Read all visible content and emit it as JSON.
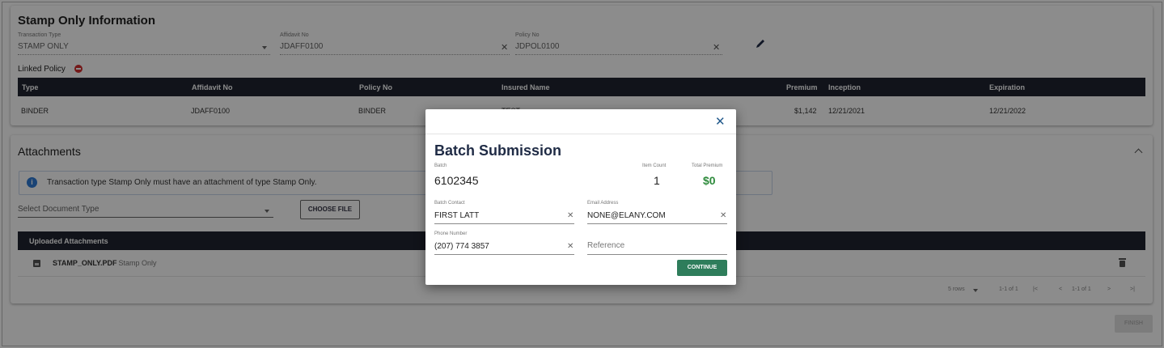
{
  "stamp": {
    "title": "Stamp Only Information",
    "transaction_type_label": "Transaction Type",
    "transaction_type_value": "STAMP ONLY",
    "affidavit_label": "Affidavit No",
    "affidavit_value": "JDAFF0100",
    "policy_label": "Policy No",
    "policy_value": "JDPOL0100",
    "linked_policy_label": "Linked Policy",
    "table": {
      "headers": [
        "Type",
        "Affidavit No",
        "Policy No",
        "Insured Name",
        "Premium",
        "Inception",
        "Expiration"
      ],
      "row": {
        "type": "BINDER",
        "affidavit": "JDAFF0100",
        "policy": "BINDER",
        "insured": "TEST",
        "premium": "$1,142",
        "inception": "12/21/2021",
        "expiration": "12/21/2022"
      }
    }
  },
  "attachments": {
    "title": "Attachments",
    "info_text": "Transaction type Stamp Only must have an attachment of type Stamp Only.",
    "doc_type_placeholder": "Select Document Type",
    "choose_file_label": "CHOOSE FILE",
    "uploaded_header": "Uploaded Attachments",
    "file_name": "STAMP_ONLY.PDF",
    "file_type": " - Stamp Only",
    "pager": {
      "rows_label": "5 rows",
      "range": "1-1 of 1",
      "range2": "1-1 of 1",
      "first": "|<",
      "prev": "<",
      "next": ">",
      "last": ">|"
    }
  },
  "finish_label": "FINISH",
  "modal": {
    "title": "Batch Submission",
    "batch_label": "Batch",
    "batch_value": "6102345",
    "item_count_label": "Item Count",
    "item_count_value": "1",
    "total_premium_label": "Total Premium",
    "total_premium_value": "$0",
    "contact_label": "Batch Contact",
    "contact_value": "FIRST LATT",
    "email_label": "Email Address",
    "email_value": "NONE@ELANY.COM",
    "phone_label": "Phone Number",
    "phone_value": "(207) 774 3857",
    "reference_placeholder": "Reference",
    "continue_label": "CONTINUE",
    "close_symbol": "✕"
  },
  "colors": {
    "header_dark": "#1f2431",
    "continue_green": "#2e7d5b",
    "premium_green": "#2e8b3c",
    "info_blue": "#2f7ad6",
    "linked_red": "#d32f2f"
  },
  "icons": [
    "edit-icon",
    "info-icon",
    "remove-icon",
    "file-icon",
    "trash-icon",
    "close-icon",
    "chevron-up-icon"
  ]
}
